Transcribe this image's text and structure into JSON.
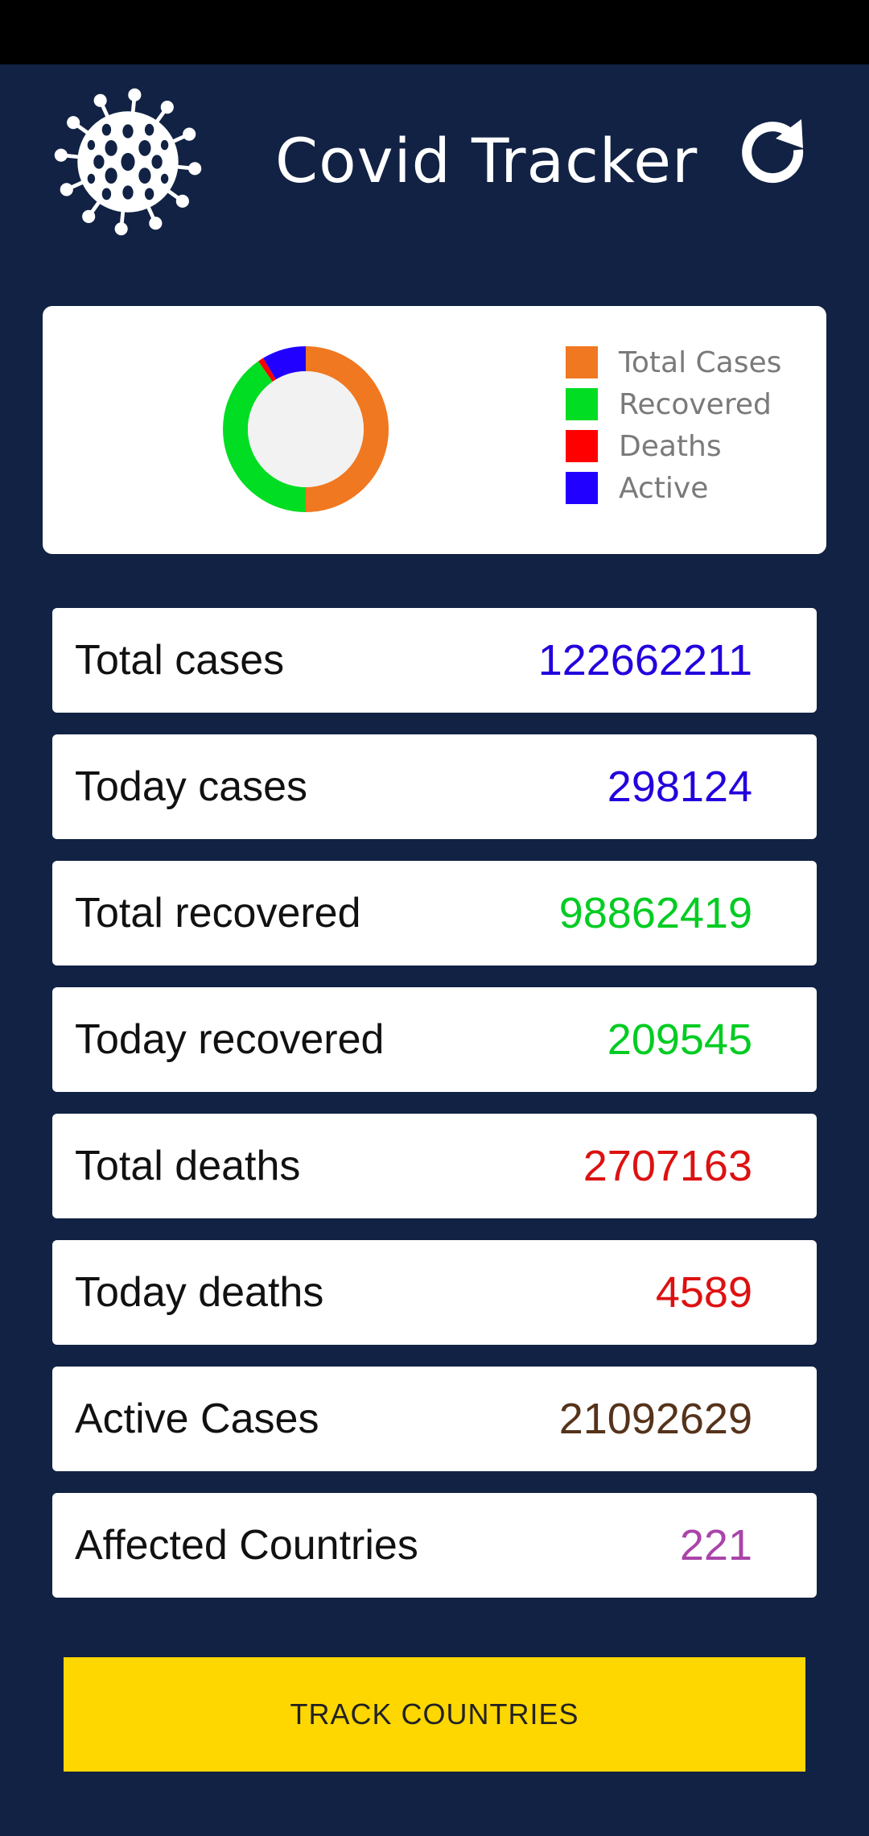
{
  "app": {
    "title": "Covid Tracker"
  },
  "icons": {
    "logo": "virus-icon",
    "refresh": "refresh-icon"
  },
  "chart_data": {
    "type": "pie",
    "subtype": "donut",
    "title": "",
    "series": [
      {
        "name": "Total Cases",
        "value": 122662211,
        "color": "#f07820"
      },
      {
        "name": "Recovered",
        "value": 98862419,
        "color": "#00dd22"
      },
      {
        "name": "Deaths",
        "value": 2707163,
        "color": "#ff0000"
      },
      {
        "name": "Active",
        "value": 21092629,
        "color": "#2200ff"
      }
    ],
    "legend": "right"
  },
  "stats": [
    {
      "label": "Total cases",
      "value": "122662211",
      "color": "#2200dd"
    },
    {
      "label": "Today cases",
      "value": "298124",
      "color": "#2200dd"
    },
    {
      "label": "Total recovered",
      "value": "98862419",
      "color": "#00cc22"
    },
    {
      "label": "Today recovered",
      "value": "209545",
      "color": "#00cc22"
    },
    {
      "label": "Total deaths",
      "value": "2707163",
      "color": "#dd1111"
    },
    {
      "label": "Today deaths",
      "value": "4589",
      "color": "#dd1111"
    },
    {
      "label": "Active Cases",
      "value": "21092629",
      "color": "#55331a"
    },
    {
      "label": "Affected Countries",
      "value": "221",
      "color": "#aa44aa"
    }
  ],
  "button": {
    "label": "TRACK COUNTRIES",
    "color": "#ffd700"
  },
  "theme": {
    "background": "#112244"
  }
}
